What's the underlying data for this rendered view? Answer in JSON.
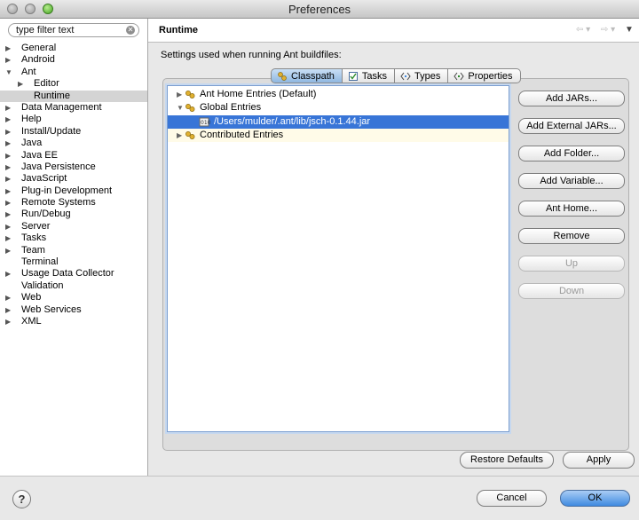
{
  "window": {
    "title": "Preferences"
  },
  "filter": {
    "placeholder": "type filter text"
  },
  "tree": [
    {
      "label": "General",
      "arrow": "▶",
      "indent": 0
    },
    {
      "label": "Android",
      "arrow": "▶",
      "indent": 0
    },
    {
      "label": "Ant",
      "arrow": "▼",
      "indent": 0
    },
    {
      "label": "Editor",
      "arrow": "▶",
      "indent": 1
    },
    {
      "label": "Runtime",
      "arrow": "",
      "indent": 1,
      "selected": true
    },
    {
      "label": "Data Management",
      "arrow": "▶",
      "indent": 0
    },
    {
      "label": "Help",
      "arrow": "▶",
      "indent": 0
    },
    {
      "label": "Install/Update",
      "arrow": "▶",
      "indent": 0
    },
    {
      "label": "Java",
      "arrow": "▶",
      "indent": 0
    },
    {
      "label": "Java EE",
      "arrow": "▶",
      "indent": 0
    },
    {
      "label": "Java Persistence",
      "arrow": "▶",
      "indent": 0
    },
    {
      "label": "JavaScript",
      "arrow": "▶",
      "indent": 0
    },
    {
      "label": "Plug-in Development",
      "arrow": "▶",
      "indent": 0
    },
    {
      "label": "Remote Systems",
      "arrow": "▶",
      "indent": 0
    },
    {
      "label": "Run/Debug",
      "arrow": "▶",
      "indent": 0
    },
    {
      "label": "Server",
      "arrow": "▶",
      "indent": 0
    },
    {
      "label": "Tasks",
      "arrow": "▶",
      "indent": 0
    },
    {
      "label": "Team",
      "arrow": "▶",
      "indent": 0
    },
    {
      "label": "Terminal",
      "arrow": "",
      "indent": 0
    },
    {
      "label": "Usage Data Collector",
      "arrow": "▶",
      "indent": 0
    },
    {
      "label": "Validation",
      "arrow": "",
      "indent": 0
    },
    {
      "label": "Web",
      "arrow": "▶",
      "indent": 0
    },
    {
      "label": "Web Services",
      "arrow": "▶",
      "indent": 0
    },
    {
      "label": "XML",
      "arrow": "▶",
      "indent": 0
    }
  ],
  "page": {
    "title": "Runtime",
    "description": "Settings used when running Ant buildfiles:"
  },
  "tabs": [
    {
      "label": "Classpath",
      "icon": "classpath-icon",
      "active": true
    },
    {
      "label": "Tasks",
      "icon": "tasks-icon",
      "active": false
    },
    {
      "label": "Types",
      "icon": "types-icon",
      "active": false
    },
    {
      "label": "Properties",
      "icon": "properties-icon",
      "active": false
    }
  ],
  "classpath": [
    {
      "label": "Ant Home Entries (Default)",
      "arrow": "▶",
      "type": "folder",
      "indent": 0
    },
    {
      "label": "Global Entries",
      "arrow": "▼",
      "type": "folder",
      "indent": 0
    },
    {
      "label": "/Users/mulder/.ant/lib/jsch-0.1.44.jar",
      "arrow": "",
      "type": "jar",
      "indent": 1,
      "selected": true
    },
    {
      "label": "Contributed Entries",
      "arrow": "▶",
      "type": "folder",
      "indent": 0
    }
  ],
  "buttons": [
    {
      "label": "Add JARs...",
      "enabled": true
    },
    {
      "label": "Add External JARs...",
      "enabled": true
    },
    {
      "label": "Add Folder...",
      "enabled": true
    },
    {
      "label": "Add Variable...",
      "enabled": true
    },
    {
      "label": "Ant Home...",
      "enabled": true
    },
    {
      "label": "Remove",
      "enabled": true
    },
    {
      "label": "Up",
      "enabled": false
    },
    {
      "label": "Down",
      "enabled": false
    }
  ],
  "actions": {
    "restore_defaults": "Restore Defaults",
    "apply": "Apply",
    "cancel": "Cancel",
    "ok": "OK",
    "help": "?"
  },
  "colors": {
    "selection": "#3875d7",
    "default_button": "#3f8ae0"
  }
}
